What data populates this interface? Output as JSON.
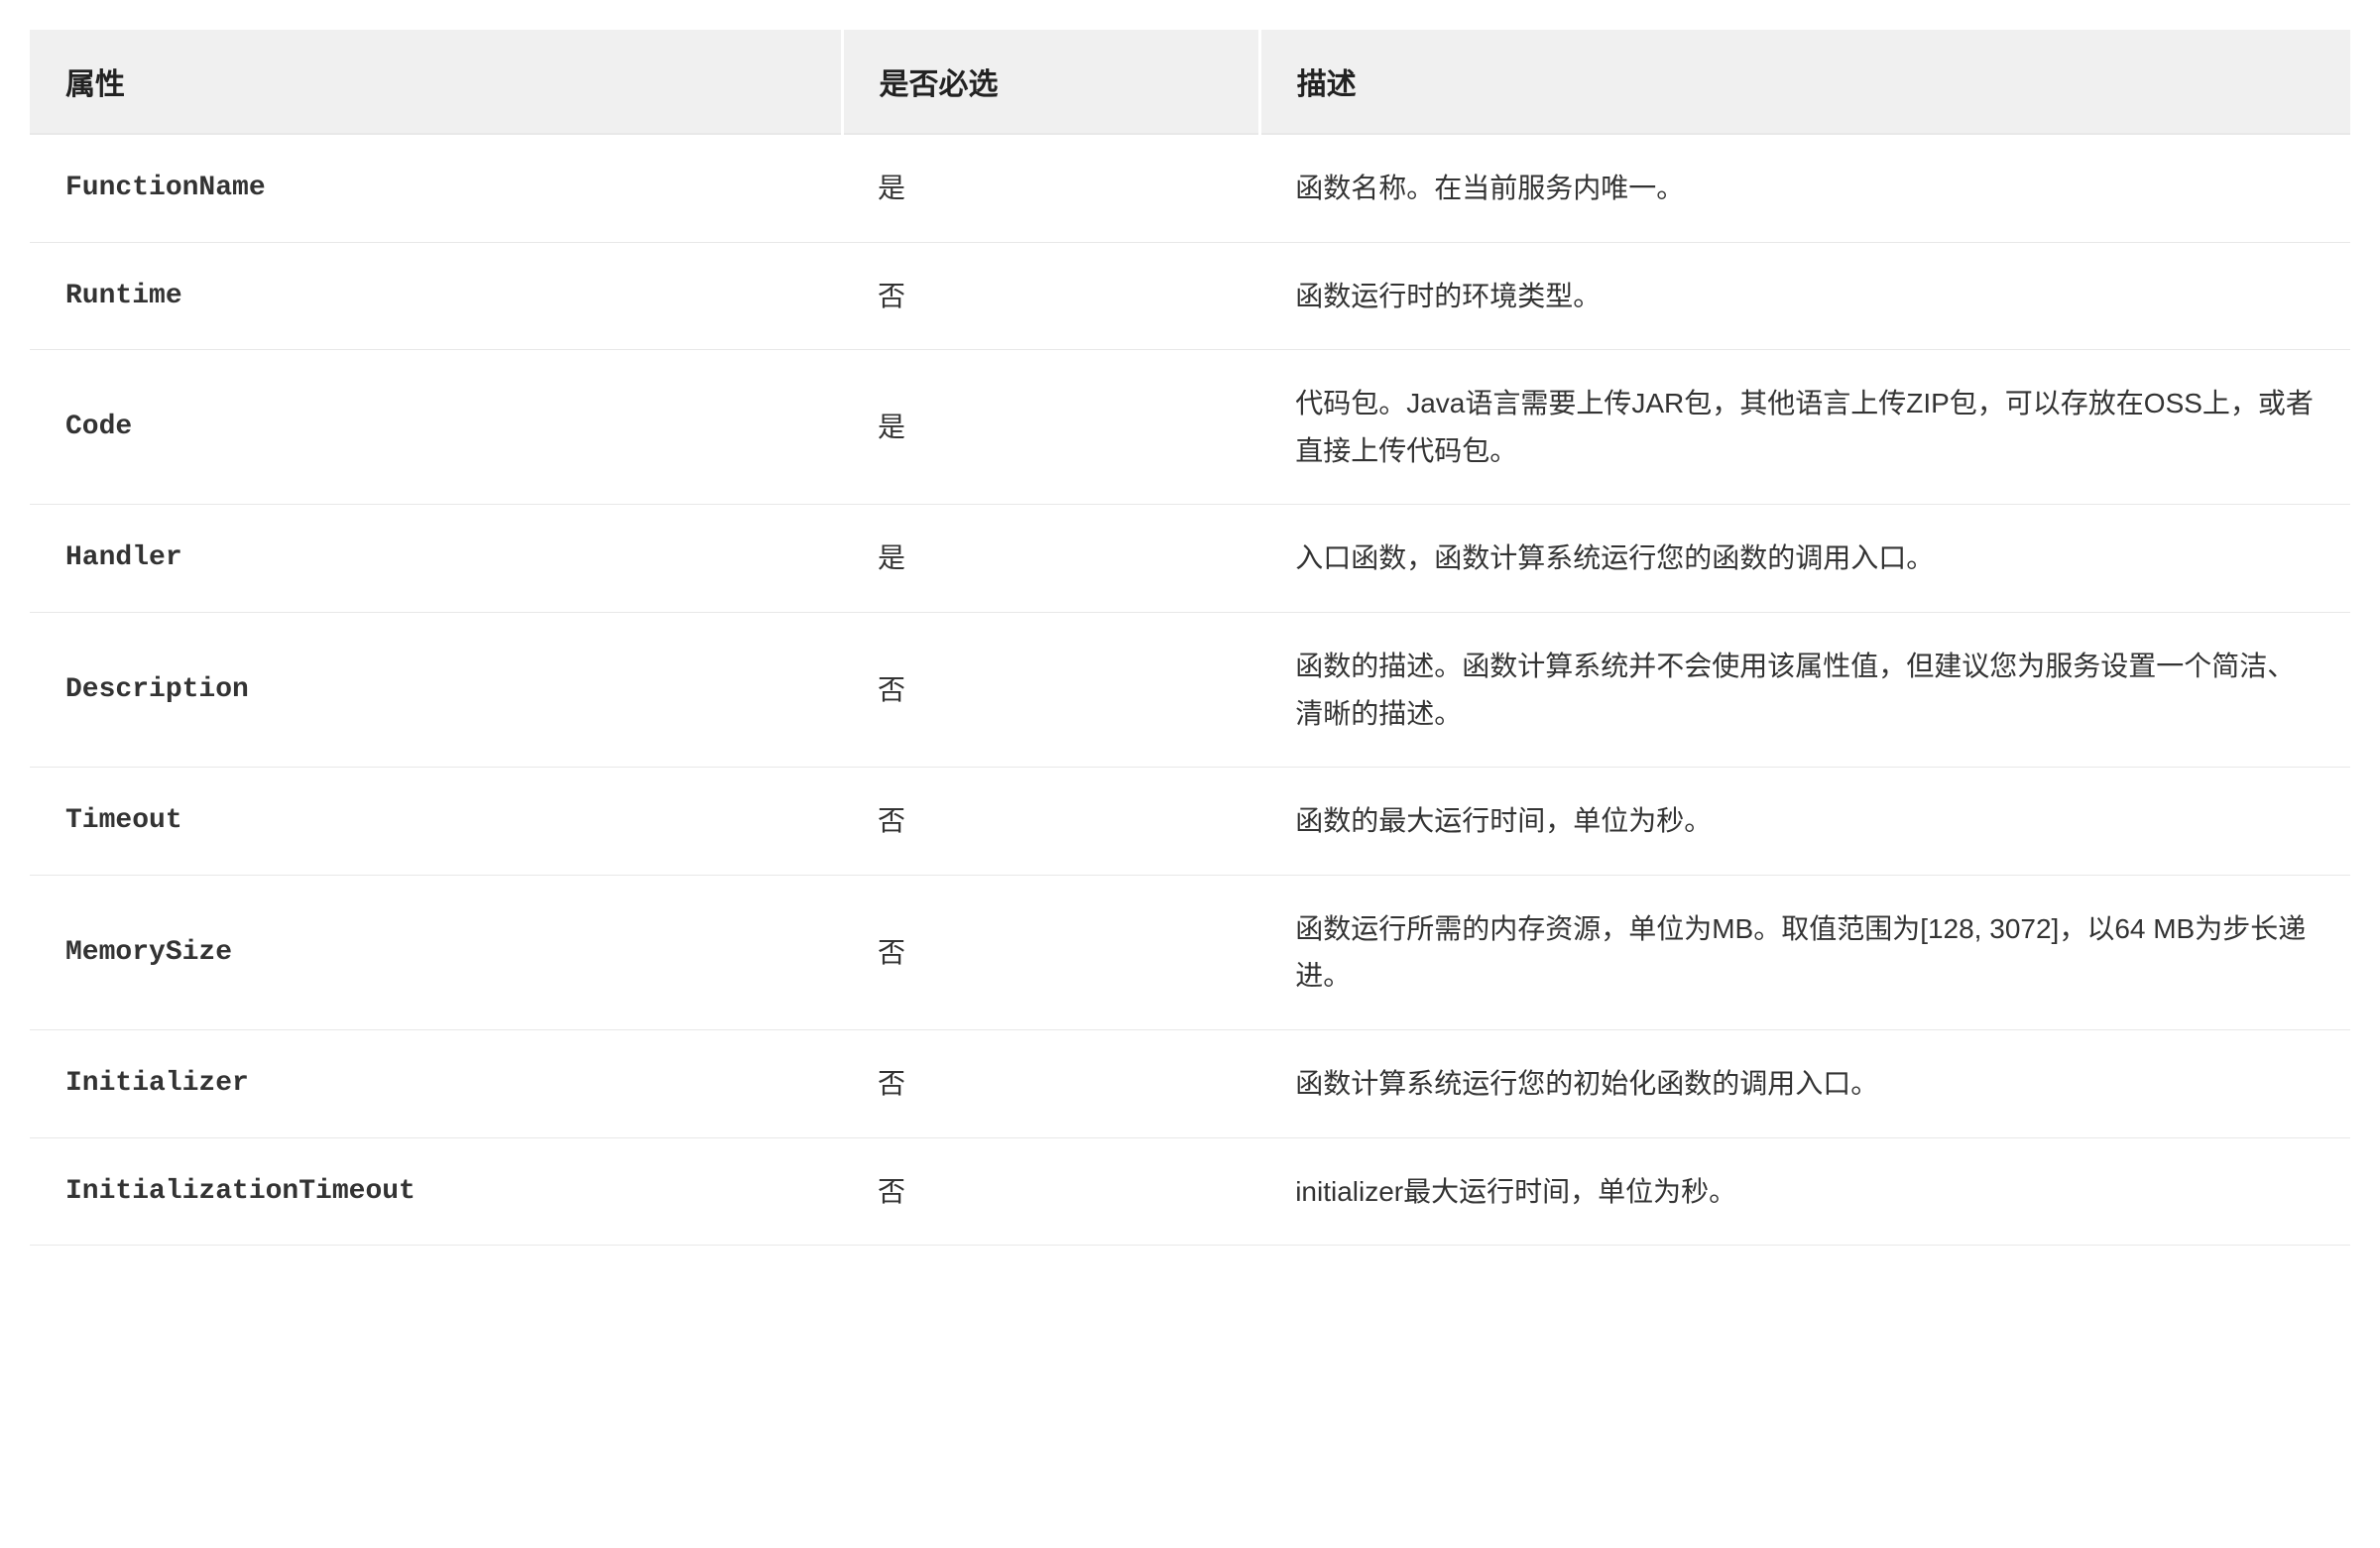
{
  "table": {
    "headers": {
      "attribute": "属性",
      "required": "是否必选",
      "description": "描述"
    },
    "rows": [
      {
        "attribute": "FunctionName",
        "required": "是",
        "description": "函数名称。在当前服务内唯一。"
      },
      {
        "attribute": "Runtime",
        "required": "否",
        "description": "函数运行时的环境类型。"
      },
      {
        "attribute": "Code",
        "required": "是",
        "description": "代码包。Java语言需要上传JAR包，其他语言上传ZIP包，可以存放在OSS上，或者直接上传代码包。"
      },
      {
        "attribute": "Handler",
        "required": "是",
        "description": "入口函数，函数计算系统运行您的函数的调用入口。"
      },
      {
        "attribute": "Description",
        "required": "否",
        "description": "函数的描述。函数计算系统并不会使用该属性值，但建议您为服务设置一个简洁、清晰的描述。"
      },
      {
        "attribute": "Timeout",
        "required": "否",
        "description": "函数的最大运行时间，单位为秒。"
      },
      {
        "attribute": "MemorySize",
        "required": "否",
        "description": "函数运行所需的内存资源，单位为MB。取值范围为[128, 3072]，以64 MB为步长递进。"
      },
      {
        "attribute": "Initializer",
        "required": "否",
        "description": "函数计算系统运行您的初始化函数的调用入口。"
      },
      {
        "attribute": "InitializationTimeout",
        "required": "否",
        "description": "initializer最大运行时间，单位为秒。"
      }
    ]
  }
}
